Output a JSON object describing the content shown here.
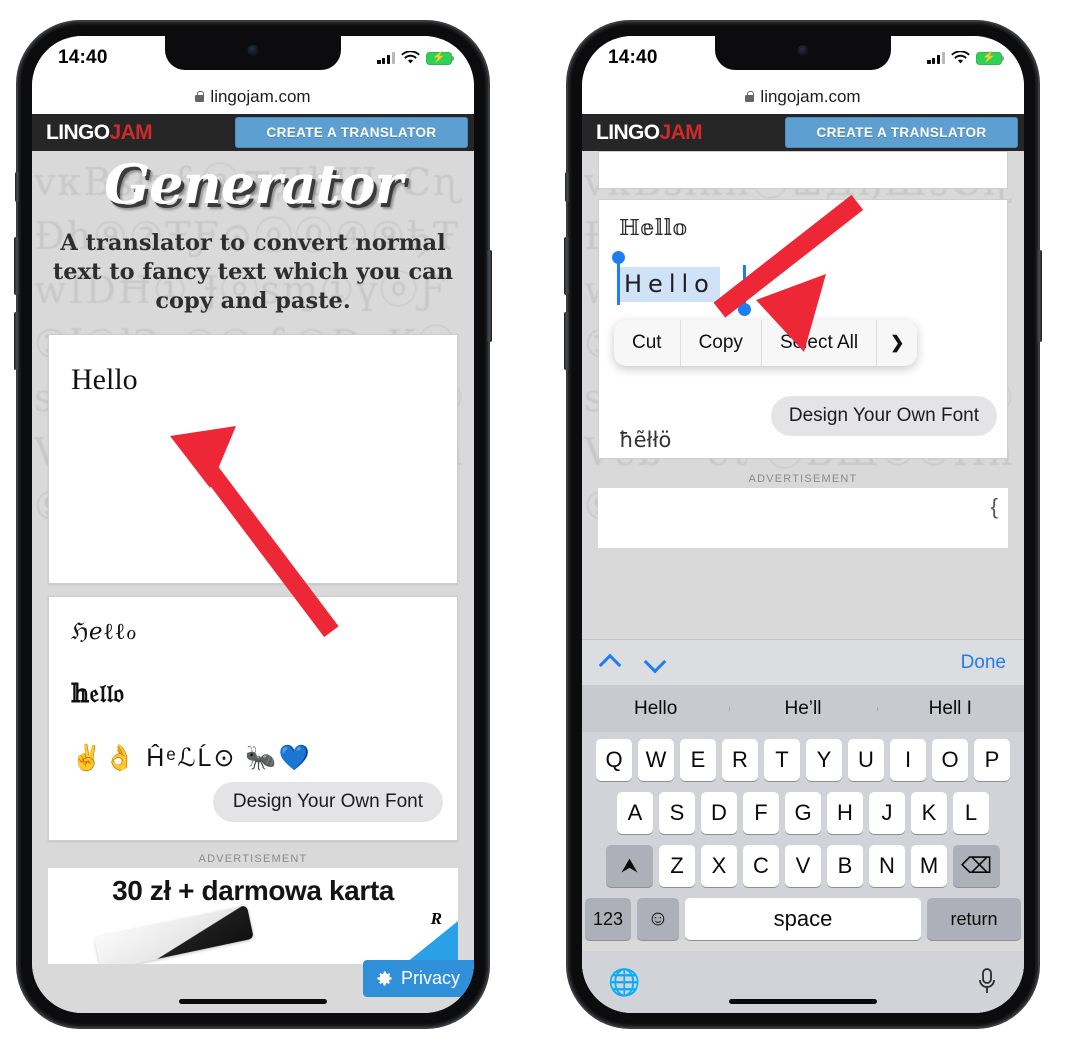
{
  "status": {
    "time": "14:40",
    "battery_charging": true
  },
  "browser": {
    "url": "lingojam.com",
    "lock_icon": "lock-icon"
  },
  "site": {
    "logo_part1": "LINGO",
    "logo_part2": "JAM",
    "cta_label": "CREATE A TRANSLATOR"
  },
  "hero": {
    "title": "Generator",
    "subtitle": "A translator to convert normal text to fancy text which you can copy and paste."
  },
  "left_phone": {
    "input_value": "Hello",
    "outputs": [
      "ℌℯℓℓℴ",
      "𝕙𝔢𝔩𝔩𝔬",
      "✌👌 ĤᵉℒĹ⊙ 🐜💙"
    ],
    "design_font_label": "Design Your Own Font",
    "ad_label": "ADVERTISEMENT",
    "ad_title": "30 zł + darmowa karta",
    "ad_mark": "R",
    "privacy_label": "Privacy",
    "privacy_icon": "gear-icon"
  },
  "right_phone": {
    "output_double_struck": "ℍ𝕖𝕝𝕝𝕠",
    "selected_text": "Hello",
    "context_menu": [
      "Cut",
      "Copy",
      "Select All"
    ],
    "context_more_icon": "chevron-right-icon",
    "design_font_label": "Design Your Own Font",
    "output_partial": "ħẽłłö",
    "ad_label": "ADVERTISEMENT"
  },
  "keyboard": {
    "up_icon": "chevron-up-icon",
    "down_icon": "chevron-down-icon",
    "done_label": "Done",
    "predictions": [
      "Hello",
      "He’ll",
      "Hell I"
    ],
    "row1": [
      "Q",
      "W",
      "E",
      "R",
      "T",
      "Y",
      "U",
      "I",
      "O",
      "P"
    ],
    "row2": [
      "A",
      "S",
      "D",
      "F",
      "G",
      "H",
      "J",
      "K",
      "L"
    ],
    "row3": [
      "Z",
      "X",
      "C",
      "V",
      "B",
      "N",
      "M"
    ],
    "shift_icon": "shift-icon",
    "backspace_icon": "backspace-icon",
    "numbers_label": "123",
    "emoji_icon": "emoji-icon",
    "space_label": "space",
    "return_label": "return",
    "globe_icon": "globe-icon",
    "mic_icon": "microphone-icon"
  },
  "annotations": {
    "arrow_color": "#ee2737",
    "left_arrow": "arrow-pointing-to-input",
    "right_arrow": "arrow-pointing-to-copy"
  },
  "bg_glyphs": "ᴠкBѕłкɦⓐ⊞ДђШsℂɳ  Đh⑨②ŦƑ⊙ⓞ⓪④⑨ђŦwÏDĦ①  Ɉⓞѕɱ①үⓞƑ①ӏ②łɁᴠ①② ɦ①DᴠKⓞѕiкᵛHɱiᵛHⓝ⑨⑨  ⓡ⑨Vᴜɓᵛᵂeℓ ⓥBШ⑨②Hɦ⑨"
}
